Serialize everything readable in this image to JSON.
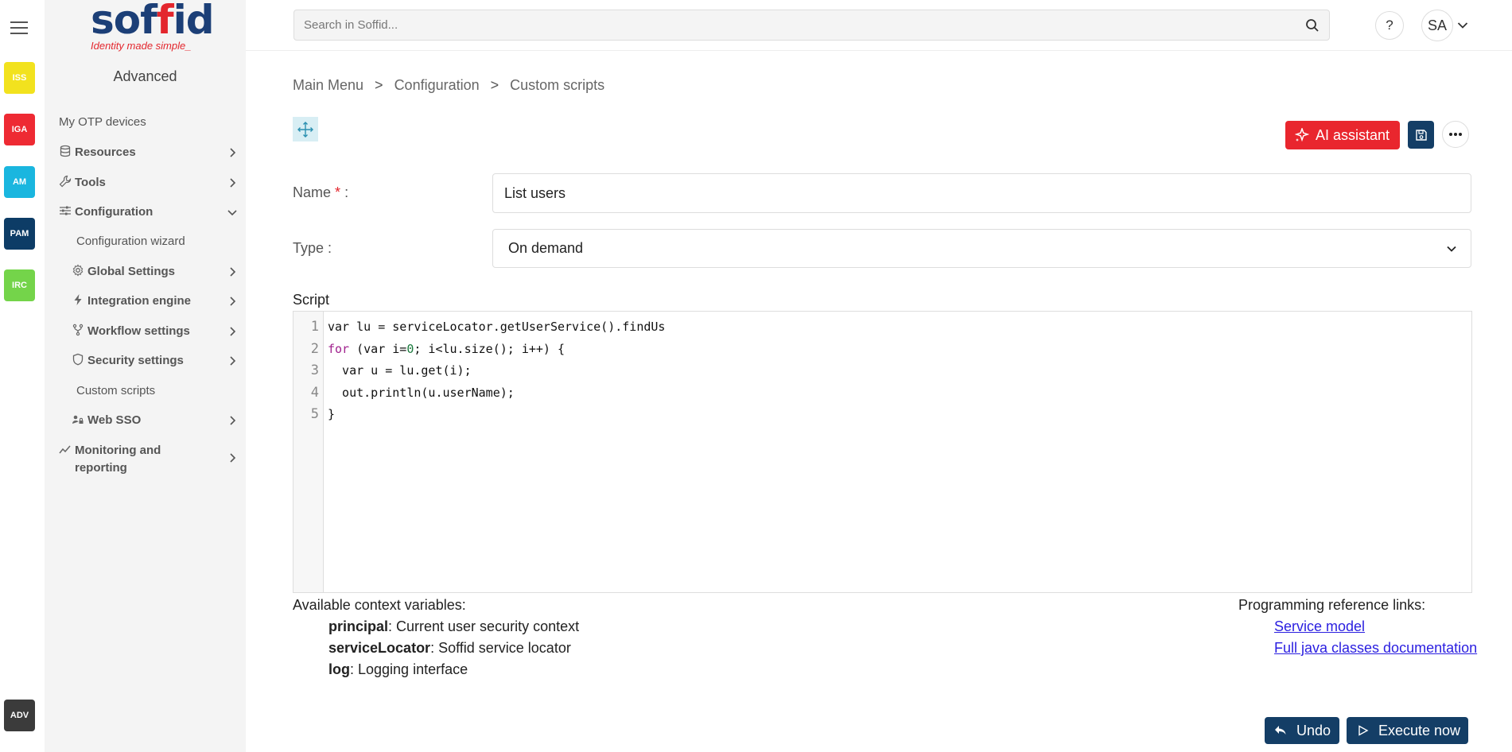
{
  "rail": {
    "badges": [
      {
        "label": "ISS",
        "color": "#f2e21e",
        "text_color": "#ffffff"
      },
      {
        "label": "IGA",
        "color": "#ee2a33"
      },
      {
        "label": "AM",
        "color": "#1ab6df"
      },
      {
        "label": "PAM",
        "color": "#0d3c66"
      },
      {
        "label": "IRC",
        "color": "#74d44a"
      },
      {
        "label": "ADV",
        "color": "#3b3b3b"
      }
    ]
  },
  "sidebar": {
    "logo_text": "soffid",
    "logo_tagline": "Identity made simple_",
    "title": "Advanced",
    "items": [
      {
        "label": "My OTP devices",
        "icon": "none"
      },
      {
        "label": "Resources",
        "icon": "database-icon"
      },
      {
        "label": "Tools",
        "icon": "wrench-icon"
      },
      {
        "label": "Configuration",
        "icon": "sliders-icon"
      },
      {
        "label": "Configuration wizard",
        "icon": "none"
      },
      {
        "label": "Global Settings",
        "icon": "gear-icon"
      },
      {
        "label": "Integration engine",
        "icon": "bolt-icon"
      },
      {
        "label": "Workflow settings",
        "icon": "fork-icon"
      },
      {
        "label": "Security settings",
        "icon": "shield-icon"
      },
      {
        "label": "Custom scripts",
        "icon": "none"
      },
      {
        "label": "Web SSO",
        "icon": "user-lock-icon"
      },
      {
        "label": "Monitoring and reporting",
        "icon": "chart-line-icon"
      }
    ]
  },
  "topbar": {
    "search_placeholder": "Search in Soffid...",
    "help_label": "?",
    "avatar_initials": "SA"
  },
  "breadcrumb": {
    "items": [
      "Main Menu",
      "Configuration",
      "Custom scripts"
    ],
    "separator": ">"
  },
  "toolbar": {
    "ai_label": "AI assistant"
  },
  "form": {
    "name_label": "Name",
    "name_required": "*",
    "name_colon": ":",
    "name_value": "List users",
    "type_label": "Type :",
    "type_value": "On demand",
    "script_label": "Script"
  },
  "editor": {
    "line_numbers": [
      "1",
      "2",
      "3",
      "4",
      "5"
    ],
    "lines": [
      "var lu = serviceLocator.getUserService().findUs",
      "for (var i=0; i<lu.size(); i++) {",
      "  var u = lu.get(i);",
      "  out.println(u.userName);",
      "}"
    ],
    "line2_parts": {
      "kw": "for",
      "a": " (var i=",
      "num": "0",
      "b": "; i<lu.size(); i++) {"
    }
  },
  "context": {
    "title": "Available context variables:",
    "vars": [
      {
        "name": "principal",
        "desc": ": Current user security context"
      },
      {
        "name": "serviceLocator",
        "desc": ": Soffid service locator"
      },
      {
        "name": "log",
        "desc": ": Logging interface"
      }
    ]
  },
  "references": {
    "title": "Programming reference links:",
    "links": [
      "Service model",
      "Full java classes documentation"
    ]
  },
  "actions": {
    "undo_label": "Undo",
    "execute_label": "Execute now"
  },
  "colors": {
    "accent_red": "#e9262e",
    "navy": "#143e66",
    "link": "#2a1ee0"
  }
}
